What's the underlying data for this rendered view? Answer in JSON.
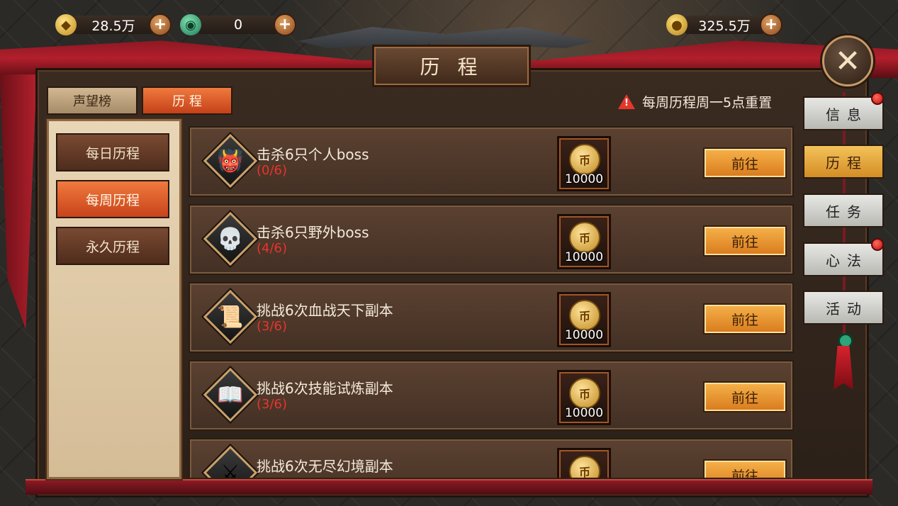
{
  "resources": {
    "ingot": {
      "value": "28.5万",
      "icon": "gold-ingot-icon"
    },
    "jade": {
      "value": "0",
      "icon": "jade-icon"
    },
    "coin": {
      "value": "325.5万",
      "icon": "coin-icon"
    }
  },
  "header": {
    "title": "历 程"
  },
  "top_tabs": [
    {
      "label": "声望榜",
      "active": false
    },
    {
      "label": "历 程",
      "active": true
    }
  ],
  "notice": {
    "text": "每周历程周一5点重置",
    "icon": "warning-icon"
  },
  "categories": [
    {
      "label": "每日历程",
      "active": false
    },
    {
      "label": "每周历程",
      "active": true
    },
    {
      "label": "永久历程",
      "active": false
    }
  ],
  "tasks": [
    {
      "name": "击杀6只个人boss",
      "progress": "(0/6)",
      "reward": "10000",
      "button": "前往",
      "icon": "demon-mask-icon"
    },
    {
      "name": "击杀6只野外boss",
      "progress": "(4/6)",
      "reward": "10000",
      "button": "前往",
      "icon": "skull-icon"
    },
    {
      "name": "挑战6次血战天下副本",
      "progress": "(3/6)",
      "reward": "10000",
      "button": "前往",
      "icon": "scroll-icon"
    },
    {
      "name": "挑战6次技能试炼副本",
      "progress": "(3/6)",
      "reward": "10000",
      "button": "前往",
      "icon": "book-icon"
    },
    {
      "name": "挑战6次无尽幻境副本",
      "progress": "",
      "reward": "",
      "button": "前往",
      "icon": "sword-crest-icon"
    }
  ],
  "side_tabs": [
    {
      "label": "信息",
      "active": false,
      "badge": true
    },
    {
      "label": "历程",
      "active": true,
      "badge": false
    },
    {
      "label": "任务",
      "active": false,
      "badge": false
    },
    {
      "label": "心法",
      "active": false,
      "badge": true
    },
    {
      "label": "活动",
      "active": false,
      "badge": false
    }
  ],
  "colors": {
    "accent_orange": "#e0662e",
    "progress_red": "#e8342c",
    "drape_red": "#b21f2c",
    "gold_button": "#f0a840"
  }
}
